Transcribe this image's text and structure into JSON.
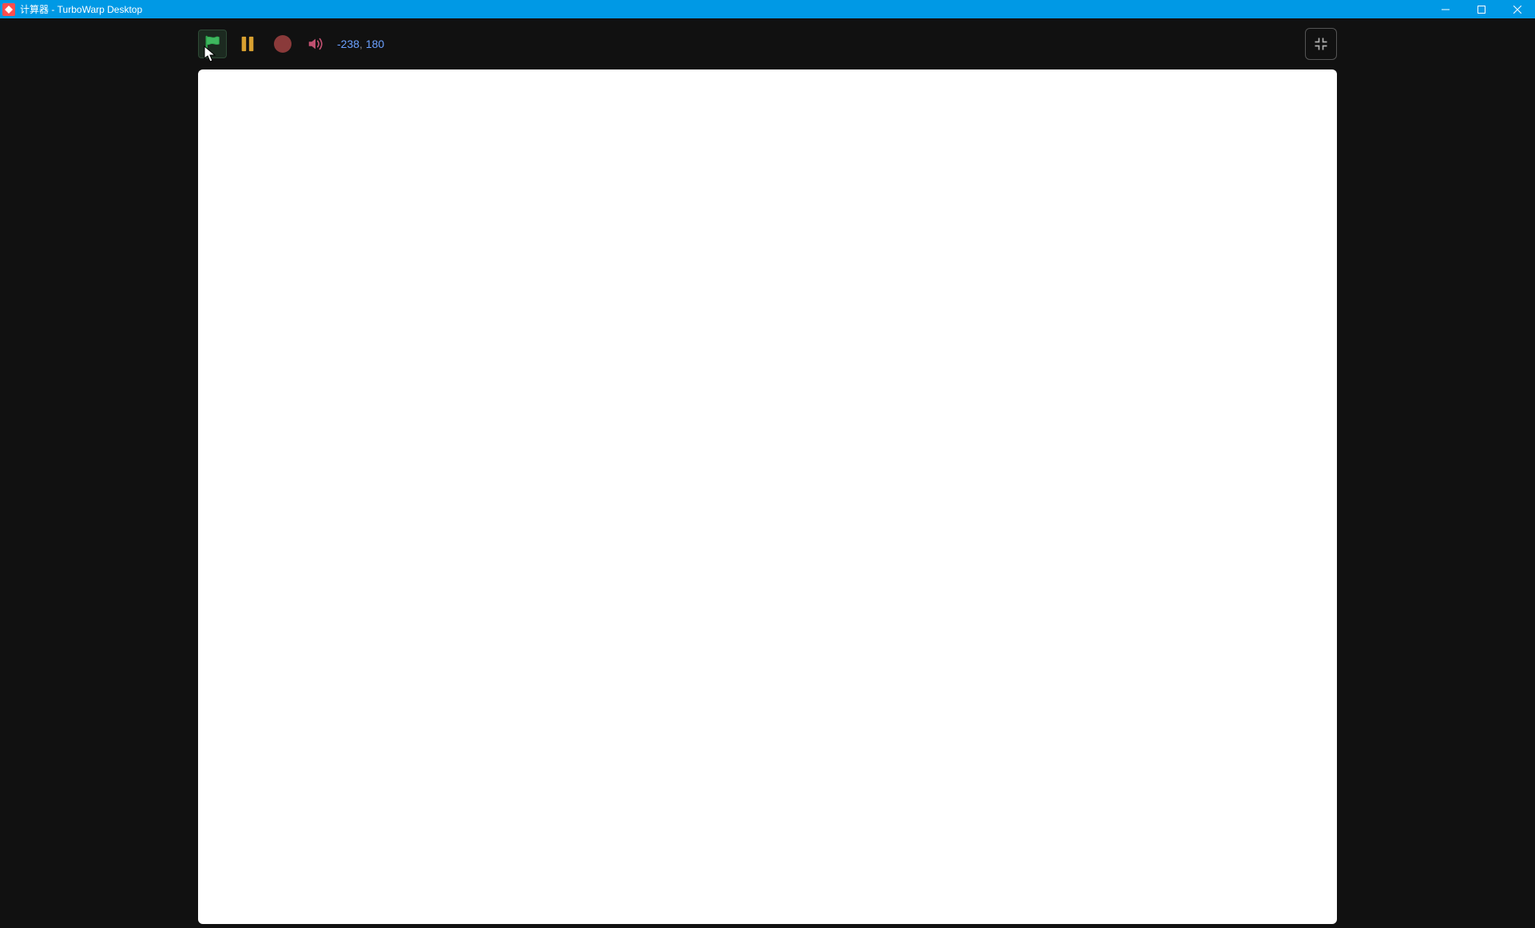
{
  "window": {
    "title": "计算器 - TurboWarp Desktop"
  },
  "toolbar": {
    "coords_x": "-238",
    "coords_sep": ", ",
    "coords_y": "180"
  }
}
